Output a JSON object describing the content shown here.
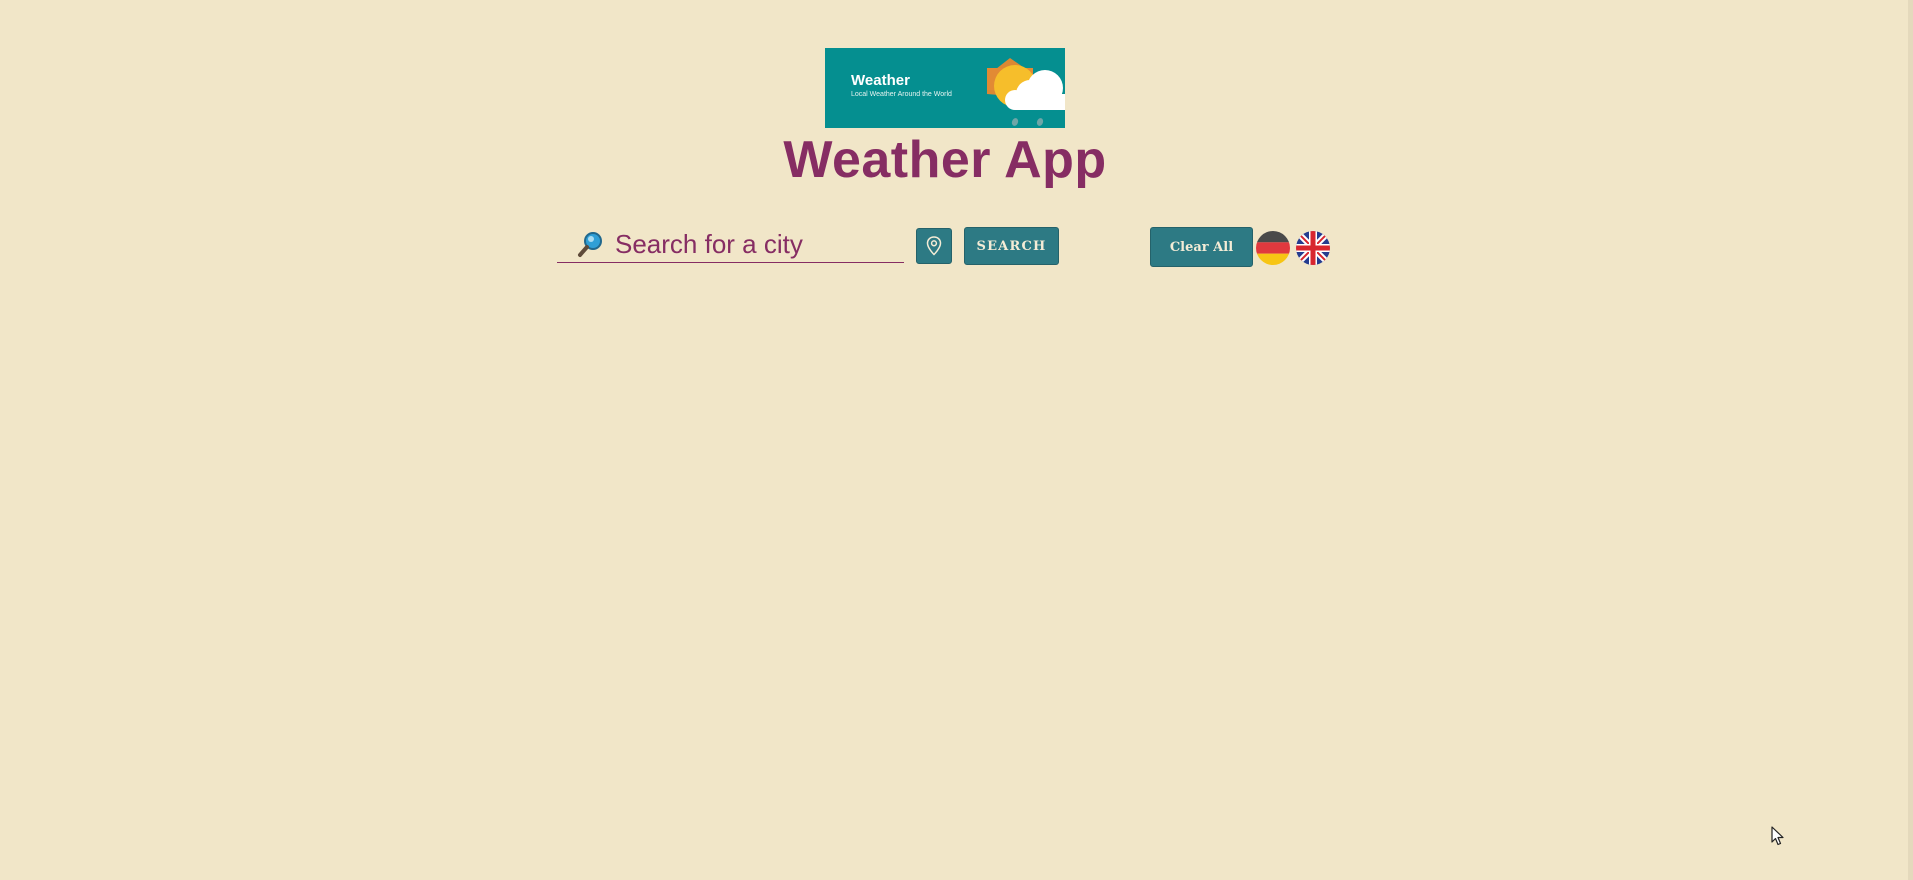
{
  "logo": {
    "title": "Weather",
    "subtitle": "Local Weather Around the World",
    "icon": "sun-cloud-rain-icon"
  },
  "header": {
    "title": "Weather App"
  },
  "search": {
    "placeholder": "Search for a city",
    "value": "",
    "icon": "search-icon"
  },
  "toolbar": {
    "location_icon": "map-pin-icon",
    "search_label": "SEARCH",
    "clear_label": "Clear All"
  },
  "languages": [
    {
      "code": "de",
      "icon": "germany-flag-icon"
    },
    {
      "code": "en",
      "icon": "uk-flag-icon"
    }
  ],
  "colors": {
    "background": "#f1e6c8",
    "accent": "#862d63",
    "button": "#2d7a84",
    "logo_background": "#058f90"
  }
}
